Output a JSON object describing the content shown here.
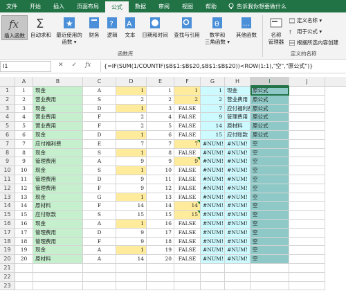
{
  "tabs": [
    "文件",
    "开始",
    "插入",
    "页面布局",
    "公式",
    "数据",
    "审阅",
    "视图",
    "帮助"
  ],
  "active_tab_index": 4,
  "tellme": "告诉我你想要做什么",
  "ribbon": {
    "insert_function": "插入函数",
    "autosum": "自动求和",
    "recent": "最近使用的\n函数 ▾",
    "financial": "财务",
    "logical": "逻辑",
    "text": "文本",
    "datetime": "日期和时间",
    "lookup": "查找与引用",
    "math": "数学和\n三角函数 ▾",
    "more": "其他函数",
    "group_library": "函数库",
    "name_manager": "名称\n管理器",
    "define_name": "定义名称 ▾",
    "use_in_formula": "用于公式 ▾",
    "create_from_selection": "根据所选内容创建",
    "group_names": "定义的名称"
  },
  "formula_bar": {
    "name_box": "I1",
    "formula": "{=IF(SUM(1/COUNTIF($B$1:$B$20,$B$1:$B$20))<ROW(1:1),\"空\",\"原公式\")}"
  },
  "columns": [
    "A",
    "B",
    "C",
    "D",
    "E",
    "F",
    "G",
    "H",
    "I",
    "J"
  ],
  "rows": [
    {
      "n": "1",
      "a": "1",
      "b": "现金",
      "c": "A",
      "d": "1",
      "e": "1",
      "f": "1",
      "g": "1",
      "h": "现金",
      "i": "原公式"
    },
    {
      "n": "2",
      "a": "2",
      "b": "营业费用",
      "c": "S",
      "d": "2",
      "e": "2",
      "f": "2",
      "g": "2",
      "h": "营业费用",
      "i": "原公式"
    },
    {
      "n": "3",
      "a": "3",
      "b": "现金",
      "c": "D",
      "d": "1",
      "e": "3",
      "f": "FALSE",
      "g": "7",
      "h": "应付福利费",
      "i": "原公式"
    },
    {
      "n": "4",
      "a": "4",
      "b": "营业费用",
      "c": "F",
      "d": "2",
      "e": "4",
      "f": "FALSE",
      "g": "9",
      "h": "管理费用",
      "i": "原公式"
    },
    {
      "n": "5",
      "a": "5",
      "b": "营业费用",
      "c": "F",
      "d": "2",
      "e": "5",
      "f": "FALSE",
      "g": "14",
      "h": "原材料",
      "i": "原公式"
    },
    {
      "n": "6",
      "a": "6",
      "b": "现金",
      "c": "D",
      "d": "1",
      "e": "6",
      "f": "FALSE",
      "g": "15",
      "h": "应付账款",
      "i": "原公式"
    },
    {
      "n": "7",
      "a": "7",
      "b": "应付福利费",
      "c": "E",
      "d": "7",
      "e": "7",
      "f": "7",
      "g": "#NUM!",
      "h": "#NUM!",
      "i": "空"
    },
    {
      "n": "8",
      "a": "8",
      "b": "现金",
      "c": "S",
      "d": "1",
      "e": "8",
      "f": "FALSE",
      "g": "#NUM!",
      "h": "#NUM!",
      "i": "空"
    },
    {
      "n": "9",
      "a": "9",
      "b": "管理费用",
      "c": "A",
      "d": "9",
      "e": "9",
      "f": "9",
      "g": "#NUM!",
      "h": "#NUM!",
      "i": "空"
    },
    {
      "n": "10",
      "a": "10",
      "b": "现金",
      "c": "S",
      "d": "1",
      "e": "10",
      "f": "FALSE",
      "g": "#NUM!",
      "h": "#NUM!",
      "i": "空"
    },
    {
      "n": "11",
      "a": "11",
      "b": "管理费用",
      "c": "D",
      "d": "9",
      "e": "11",
      "f": "FALSE",
      "g": "#NUM!",
      "h": "#NUM!",
      "i": "空"
    },
    {
      "n": "12",
      "a": "12",
      "b": "管理费用",
      "c": "F",
      "d": "9",
      "e": "12",
      "f": "FALSE",
      "g": "#NUM!",
      "h": "#NUM!",
      "i": "空"
    },
    {
      "n": "13",
      "a": "13",
      "b": "现金",
      "c": "G",
      "d": "1",
      "e": "13",
      "f": "FALSE",
      "g": "#NUM!",
      "h": "#NUM!",
      "i": "空"
    },
    {
      "n": "14",
      "a": "14",
      "b": "原材料",
      "c": "F",
      "d": "14",
      "e": "14",
      "f": "14",
      "g": "#NUM!",
      "h": "#NUM!",
      "i": "空"
    },
    {
      "n": "15",
      "a": "15",
      "b": "应付账款",
      "c": "S",
      "d": "15",
      "e": "15",
      "f": "15",
      "g": "#NUM!",
      "h": "#NUM!",
      "i": "空"
    },
    {
      "n": "16",
      "a": "16",
      "b": "现金",
      "c": "A",
      "d": "1",
      "e": "16",
      "f": "FALSE",
      "g": "#NUM!",
      "h": "#NUM!",
      "i": "空"
    },
    {
      "n": "17",
      "a": "17",
      "b": "管理费用",
      "c": "D",
      "d": "9",
      "e": "17",
      "f": "FALSE",
      "g": "#NUM!",
      "h": "#NUM!",
      "i": "空"
    },
    {
      "n": "18",
      "a": "18",
      "b": "管理费用",
      "c": "F",
      "d": "9",
      "e": "18",
      "f": "FALSE",
      "g": "#NUM!",
      "h": "#NUM!",
      "i": "空"
    },
    {
      "n": "19",
      "a": "19",
      "b": "现金",
      "c": "A",
      "d": "1",
      "e": "19",
      "f": "FALSE",
      "g": "#NUM!",
      "h": "#NUM!",
      "i": "空"
    },
    {
      "n": "20",
      "a": "20",
      "b": "原材料",
      "c": "A",
      "d": "14",
      "e": "20",
      "f": "FALSE",
      "g": "#NUM!",
      "h": "#NUM!",
      "i": "空"
    },
    {
      "n": "21"
    },
    {
      "n": "22"
    },
    {
      "n": "23"
    }
  ],
  "colors": {
    "accent": "#217346",
    "green_fill": "#c6efce",
    "yellow_fill": "#ffeb9c",
    "light_blue_fill": "#ccfaff",
    "teal_fill": "#8fc9c7"
  }
}
